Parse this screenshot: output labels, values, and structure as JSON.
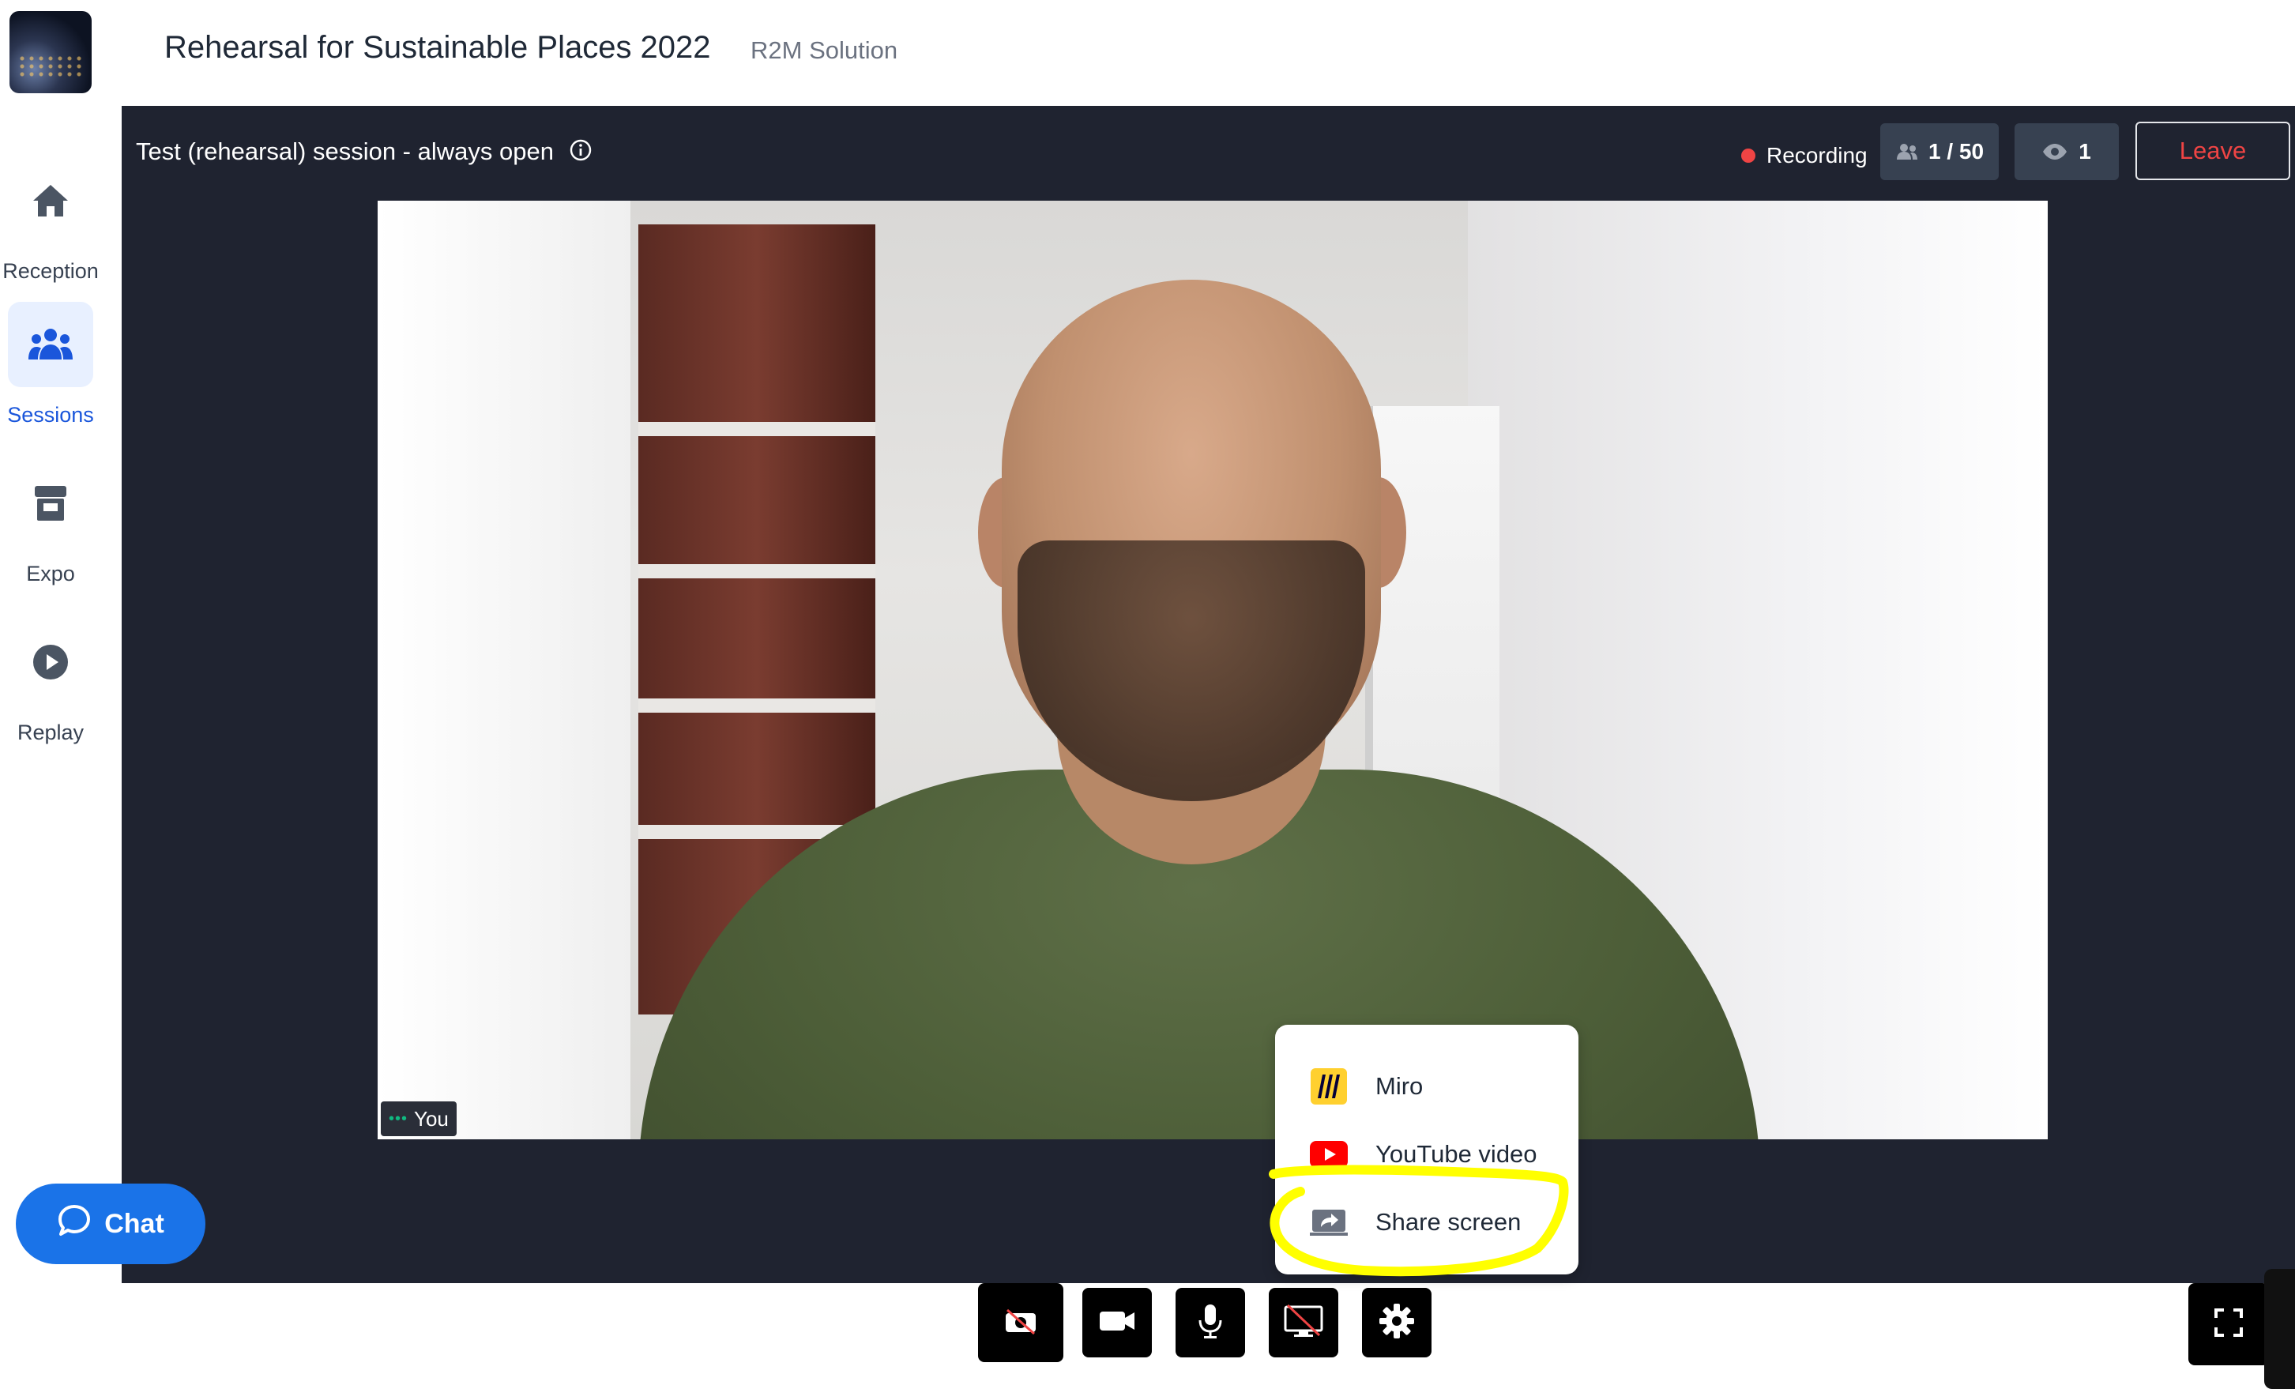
{
  "header": {
    "event_title": "Rehearsal for Sustainable Places 2022",
    "organization": "R2M Solution"
  },
  "sidebar": {
    "items": [
      {
        "label": "Reception",
        "icon": "home-icon",
        "active": false
      },
      {
        "label": "Sessions",
        "icon": "people-icon",
        "active": true
      },
      {
        "label": "Expo",
        "icon": "booth-icon",
        "active": false
      },
      {
        "label": "Replay",
        "icon": "play-circle-icon",
        "active": false
      }
    ]
  },
  "session": {
    "title": "Test (rehearsal) session - always open",
    "recording_label": "Recording",
    "participants": "1 / 50",
    "viewers": "1",
    "leave_label": "Leave"
  },
  "video": {
    "participant_name": "You"
  },
  "share_menu": {
    "items": [
      {
        "label": "Miro",
        "icon": "miro-icon"
      },
      {
        "label": "YouTube video",
        "icon": "youtube-icon"
      },
      {
        "label": "Share screen",
        "icon": "share-screen-icon"
      }
    ]
  },
  "controls": {
    "items": [
      "camera-off-icon",
      "video-camera-icon",
      "microphone-icon",
      "screen-share-off-icon",
      "settings-gear-icon"
    ],
    "fullscreen_icon": "fullscreen-icon"
  },
  "chat": {
    "label": "Chat"
  },
  "colors": {
    "accent": "#1a73e8",
    "stage_bg": "#1f2330",
    "recording": "#ef4444",
    "leave_text": "#ef4444",
    "highlight": "#ffff00"
  }
}
